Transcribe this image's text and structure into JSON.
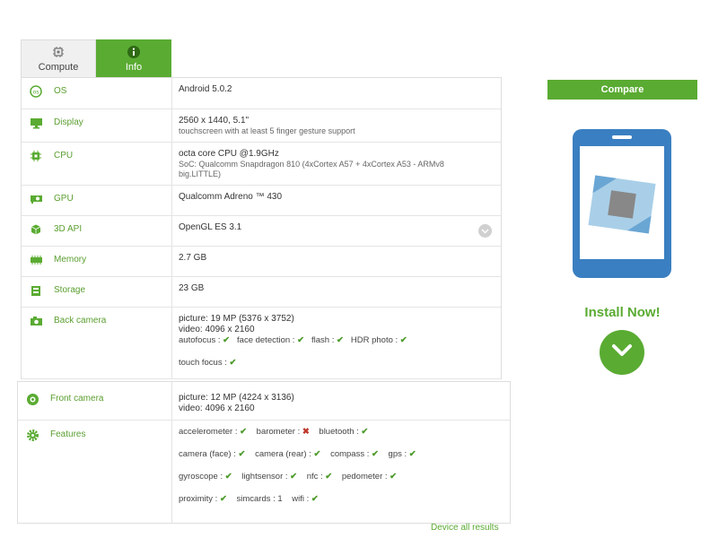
{
  "tabs": [
    {
      "label": "Compute",
      "icon": "cpu-chip-icon"
    },
    {
      "label": "Info",
      "icon": "info-circle-icon"
    }
  ],
  "specs": {
    "os": {
      "label": "OS",
      "value": "Android 5.0.2"
    },
    "display": {
      "label": "Display",
      "value": "2560 x 1440, 5.1\"",
      "sub": "touchscreen with at least 5 finger gesture support"
    },
    "cpu": {
      "label": "CPU",
      "value": "octa core CPU @1.9GHz",
      "sub1": "SoC: Qualcomm Snapdragon 810 (4xCortex A57 + 4xCortex A53 - ARMv8",
      "sub2": "big.LITTLE)"
    },
    "gpu": {
      "label": "GPU",
      "value": "Qualcomm Adreno ™ 430"
    },
    "api3d": {
      "label": "3D API",
      "value": "OpenGL ES 3.1"
    },
    "memory": {
      "label": "Memory",
      "value": "2.7 GB"
    },
    "storage": {
      "label": "Storage",
      "value": "23 GB"
    },
    "back_camera": {
      "label": "Back camera",
      "picture": "picture: 19 MP (5376 x 3752)",
      "video": "video: 4096 x 2160",
      "features": {
        "autofocus": "autofocus :",
        "face_detection": "face detection :",
        "flash": "flash :",
        "hdr": "HDR photo :",
        "touch_focus": "touch focus :"
      }
    },
    "front_camera": {
      "label": "Front camera",
      "picture": "picture: 12 MP (4224 x 3136)",
      "video": "video: 4096 x 2160"
    },
    "features": {
      "label": "Features",
      "accelerometer": "accelerometer :",
      "barometer": "barometer :",
      "bluetooth": "bluetooth :",
      "camera_face": "camera (face) :",
      "camera_rear": "camera (rear) :",
      "compass": "compass :",
      "gps": "gps :",
      "gyroscope": "gyroscope :",
      "lightsensor": "lightsensor :",
      "nfc": "nfc :",
      "pedometer": "pedometer :",
      "proximity": "proximity :",
      "simcards": "simcards : 1",
      "wifi": "wifi :"
    }
  },
  "compare_label": "Compare",
  "install_label": "Install Now!",
  "footer_link": "Device all results",
  "colors": {
    "accent": "#5aab32",
    "phone_body": "#3a7fc1",
    "phone_screen": "#ffffff"
  }
}
